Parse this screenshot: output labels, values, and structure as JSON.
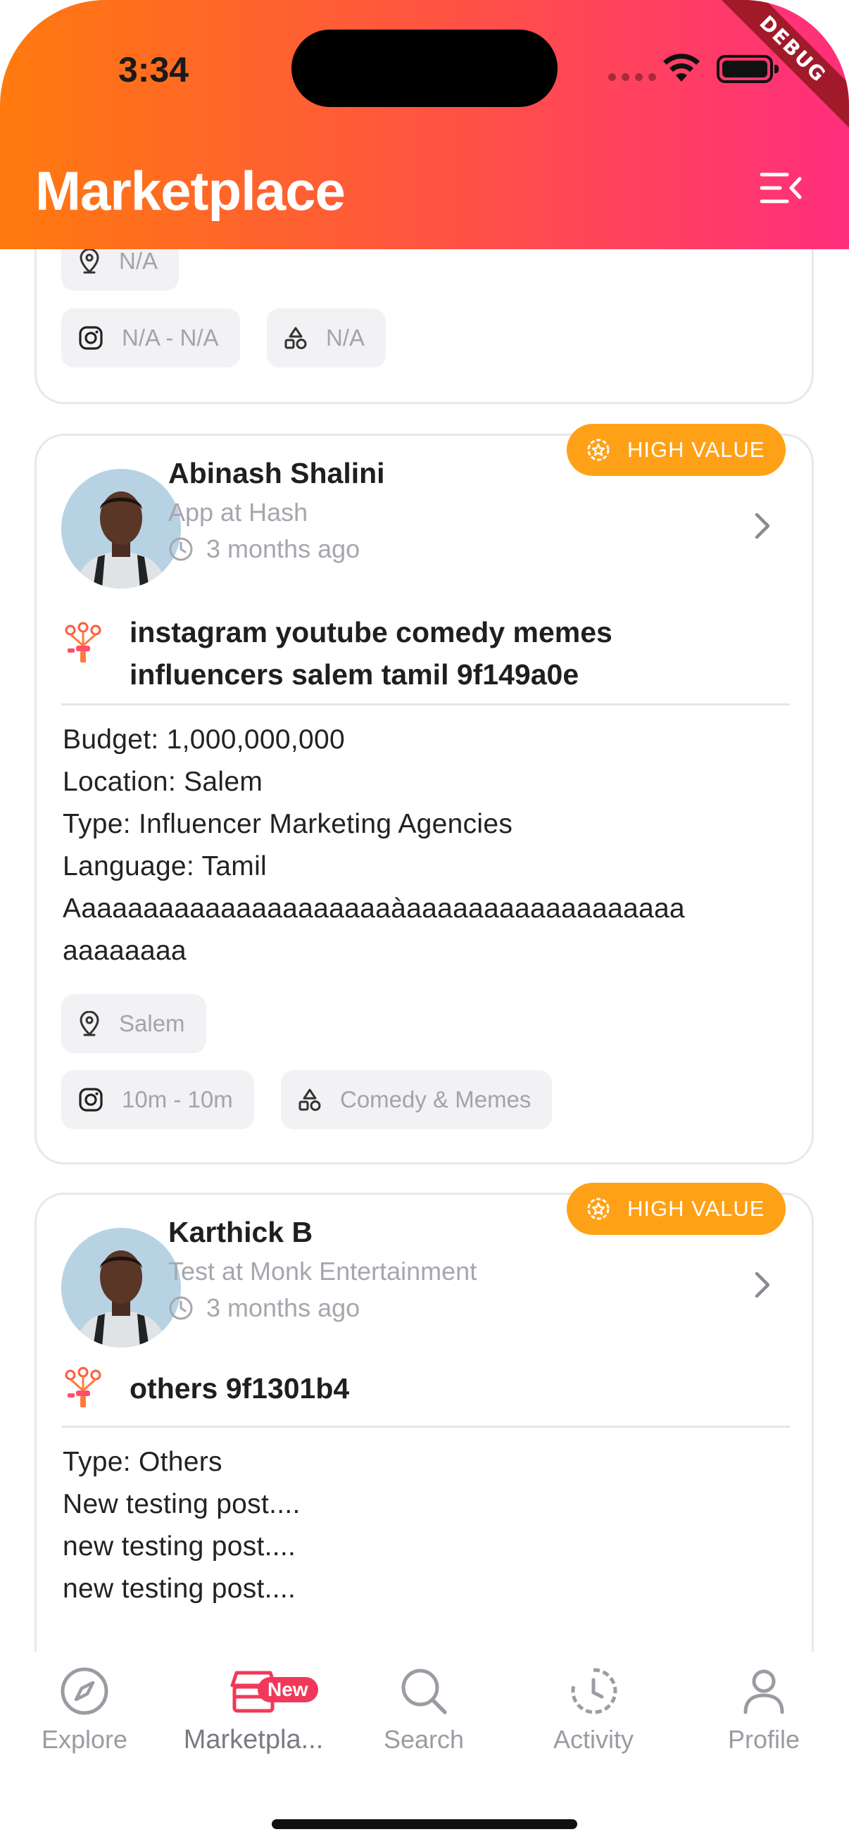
{
  "status_bar": {
    "time": "3:34"
  },
  "debug_label": "DEBUG",
  "header": {
    "title": "Marketplace"
  },
  "top_card": {
    "location": "N/A",
    "followers": "N/A - N/A",
    "category": "N/A"
  },
  "cards": [
    {
      "badge": "HIGH VALUE",
      "name": "Abinash Shalini",
      "role": "App at Hash",
      "time": "3 months ago",
      "title": "instagram youtube comedy memes influencers salem tamil 9f149a0e",
      "description": "Budget: 1,000,000,000\nLocation: Salem\nType: Influencer Marketing Agencies\nLanguage: Tamil\nAaaaaaaaaaaaaaaaaaaaaàaaaaaaaaaaaaaaaaaa\naaaaaaaa",
      "location": "Salem",
      "followers": "10m - 10m",
      "category": "Comedy & Memes"
    },
    {
      "badge": "HIGH VALUE",
      "name": "Karthick B",
      "role": "Test at Monk Entertainment",
      "time": "3 months ago",
      "title": "others 9f1301b4",
      "description": "Type: Others\nNew testing post....\nnew testing post....\nnew testing post...."
    }
  ],
  "bottom_nav": {
    "items": [
      {
        "label": "Explore",
        "icon": "compass-icon"
      },
      {
        "label": "Marketpla...",
        "icon": "store-icon",
        "badge": "New"
      },
      {
        "label": "Search",
        "icon": "search-icon"
      },
      {
        "label": "Activity",
        "icon": "history-icon"
      },
      {
        "label": "Profile",
        "icon": "person-icon"
      }
    ]
  },
  "colors": {
    "header_gradient_start": "#ff7a0e",
    "header_gradient_end": "#ff2e7c",
    "badge": "#ffa116",
    "new_badge": "#f0395a"
  }
}
